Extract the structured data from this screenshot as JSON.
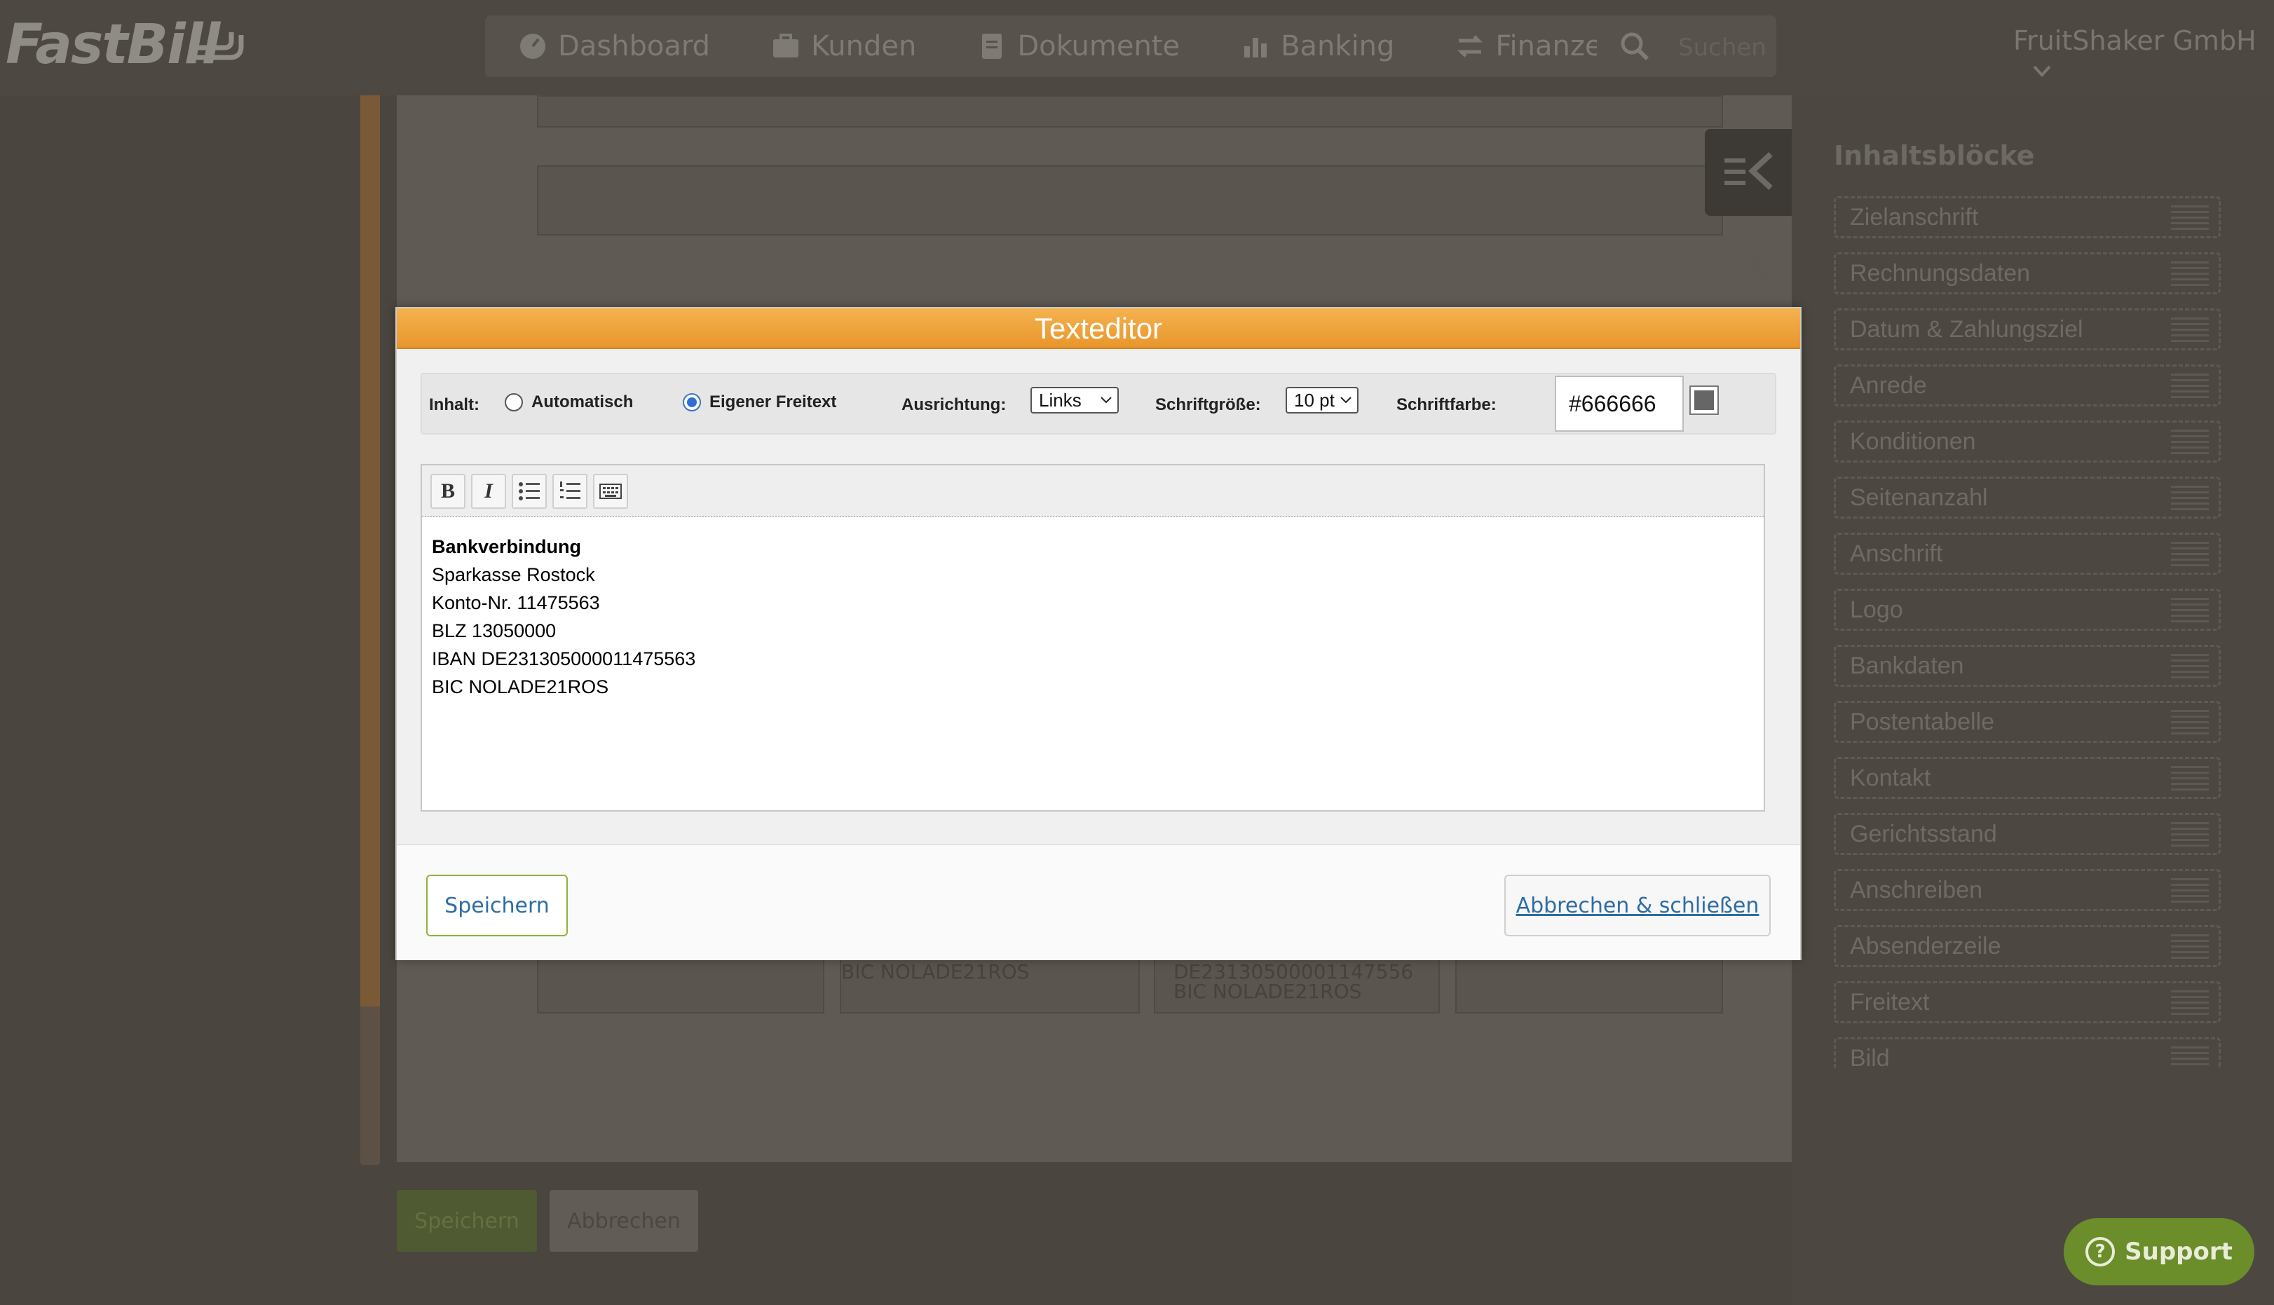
{
  "app": {
    "logo_text": "FastBill",
    "company": "FruitShaker GmbH"
  },
  "nav": {
    "items": [
      {
        "label": "Dashboard",
        "icon": "dashboard-icon"
      },
      {
        "label": "Kunden",
        "icon": "briefcase-icon"
      },
      {
        "label": "Dokumente",
        "icon": "document-icon"
      },
      {
        "label": "Banking",
        "icon": "bar-chart-icon"
      },
      {
        "label": "Finanzen",
        "icon": "transfer-icon"
      }
    ],
    "search_placeholder": "Suchen"
  },
  "background": {
    "ghost_lines": [
      "BIC NOLADE21ROS",
      "DE23130500001147556",
      "BIC NOLADE21ROS"
    ],
    "save_label": "Speichern",
    "cancel_label": "Abbrechen"
  },
  "right_panel": {
    "title": "Inhaltsblöcke",
    "blocks": [
      "Zielanschrift",
      "Rechnungsdaten",
      "Datum & Zahlungsziel",
      "Anrede",
      "Konditionen",
      "Seitenanzahl",
      "Anschrift",
      "Logo",
      "Bankdaten",
      "Postentabelle",
      "Kontakt",
      "Gerichtsstand",
      "Anschreiben",
      "Absenderzeile",
      "Freitext",
      "Bild"
    ]
  },
  "support": {
    "label": "Support"
  },
  "modal": {
    "title": "Texteditor",
    "inhalt_label": "Inhalt:",
    "option_auto": "Automatisch",
    "option_custom": "Eigener Freitext",
    "selected_option": "Eigener Freitext",
    "alignment_label": "Ausrichtung:",
    "alignment_value": "Links",
    "fontsize_label": "Schriftgröße:",
    "fontsize_value": "10 pt",
    "fontcolor_label": "Schriftfarbe:",
    "fontcolor_value": "#666666",
    "toolbar": {
      "bold": "B",
      "italic": "I"
    },
    "content_lines": [
      "Bankverbindung",
      "Sparkasse Rostock",
      "Konto-Nr. 11475563",
      "BLZ 13050000",
      "IBAN DE23130500001147556‌3",
      "BIC NOLADE21ROS"
    ],
    "save_label": "Speichern",
    "close_label": "Abbrechen & schließen"
  },
  "colors": {
    "header_orange": "#f0a53e",
    "link_blue": "#2e6da4",
    "save_border_green": "#8fb33a",
    "support_green": "#6b8d2a"
  }
}
